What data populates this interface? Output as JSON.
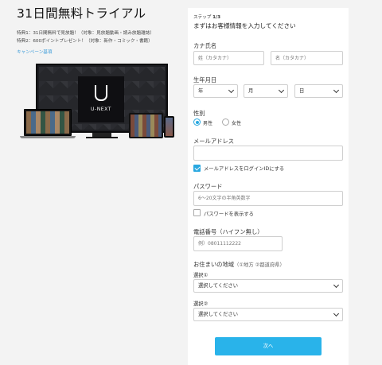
{
  "left": {
    "title": "31日間無料トライアル",
    "perk1": "特典1：31日間無料で見放題！（対象：見放題動画・読み放題雑誌）",
    "perk2": "特典2：600ポイントプレゼント！（対象：新作・コミック・書籍）",
    "campaign_link": "キャンペーン基項",
    "logo_text": "U-NEXT"
  },
  "form": {
    "step_prefix": "ステップ ",
    "step_value": "1/3",
    "heading": "まずはお客様情報を入力してください",
    "name": {
      "label": "カナ氏名",
      "last_placeholder": "姓（カタカナ）",
      "first_placeholder": "名（カタカナ）"
    },
    "birthday": {
      "label": "生年月日",
      "year": "年",
      "month": "月",
      "day": "日"
    },
    "gender": {
      "label": "性別",
      "male": "男性",
      "female": "女性",
      "selected": "male"
    },
    "email": {
      "label": "メールアドレス",
      "value": "",
      "login_id_label": "メールアドレスをログインIDにする",
      "login_id_checked": true
    },
    "password": {
      "label": "パスワード",
      "placeholder": "6〜20文字の半角英数字",
      "show_label": "パスワードを表示する",
      "show_checked": false
    },
    "phone": {
      "label": "電話番号（ハイフン無し）",
      "placeholder": "例）08011112222"
    },
    "region": {
      "label": "お住まいの地域",
      "hint": "（①地方 ②都道府県）",
      "select1_label": "選択①",
      "select1_value": "選択してください",
      "select2_label": "選択②",
      "select2_value": "選択してください"
    },
    "next_label": "次へ"
  },
  "colors": {
    "accent": "#29b3ea",
    "link": "#3a9ad8",
    "background": "#f3f3f3"
  }
}
